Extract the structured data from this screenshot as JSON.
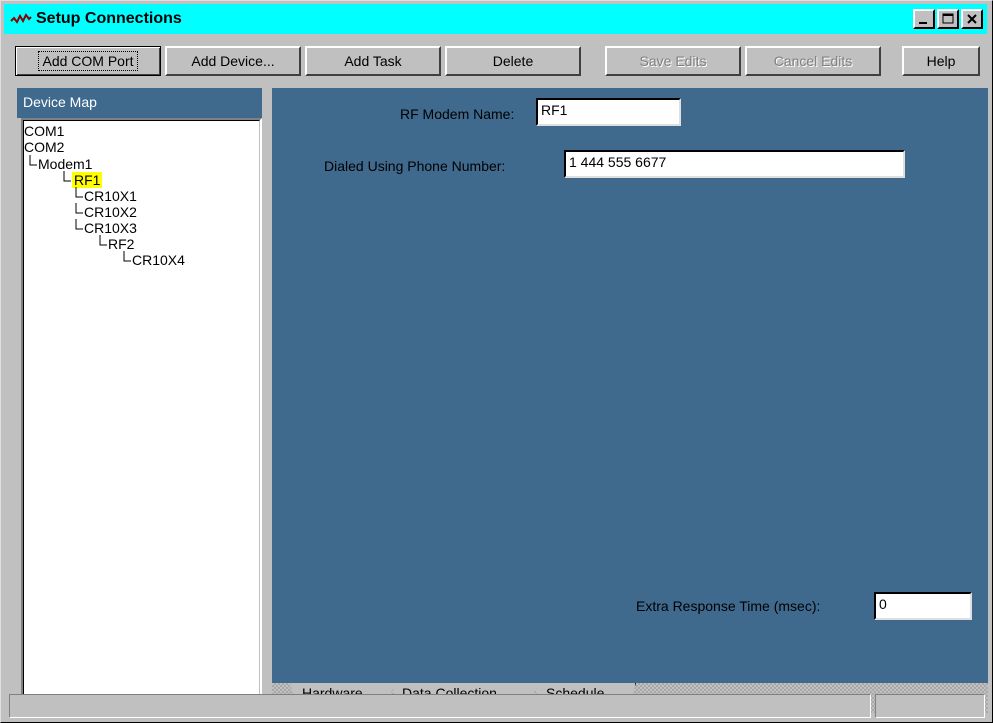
{
  "window": {
    "title": "Setup Connections",
    "controls": {
      "minimize": "_",
      "maximize": "□",
      "close": "×"
    }
  },
  "toolbar": {
    "add_com_port": "Add COM Port",
    "add_device": "Add Device...",
    "add_task": "Add Task",
    "delete": "Delete",
    "save_edits": "Save Edits",
    "cancel_edits": "Cancel Edits",
    "help": "Help"
  },
  "sidebar": {
    "title": "Device Map",
    "tree": [
      {
        "label": "COM1",
        "depth": 0
      },
      {
        "label": "COM2",
        "depth": 0
      },
      {
        "label": "Modem1",
        "depth": 1
      },
      {
        "label": "RF1",
        "depth": 2,
        "selected": true
      },
      {
        "label": "CR10X1",
        "depth": 3
      },
      {
        "label": "CR10X2",
        "depth": 3
      },
      {
        "label": "CR10X3",
        "depth": 3
      },
      {
        "label": "RF2",
        "depth": 4
      },
      {
        "label": "CR10X4",
        "depth": 5
      }
    ]
  },
  "form": {
    "rf_modem_name_label": "RF Modem Name:",
    "rf_modem_name_value": "RF1",
    "phone_label": "Dialed Using Phone Number:",
    "phone_value": "1 444 555 6677",
    "extra_response_label": "Extra Response Time (msec):",
    "extra_response_value": "0"
  },
  "tabs": [
    "Hardware",
    "Data Collection",
    "Schedule"
  ],
  "colors": {
    "titlebar": "#00ffff",
    "panel": "#3f6a8e",
    "selection": "#ffff00"
  }
}
